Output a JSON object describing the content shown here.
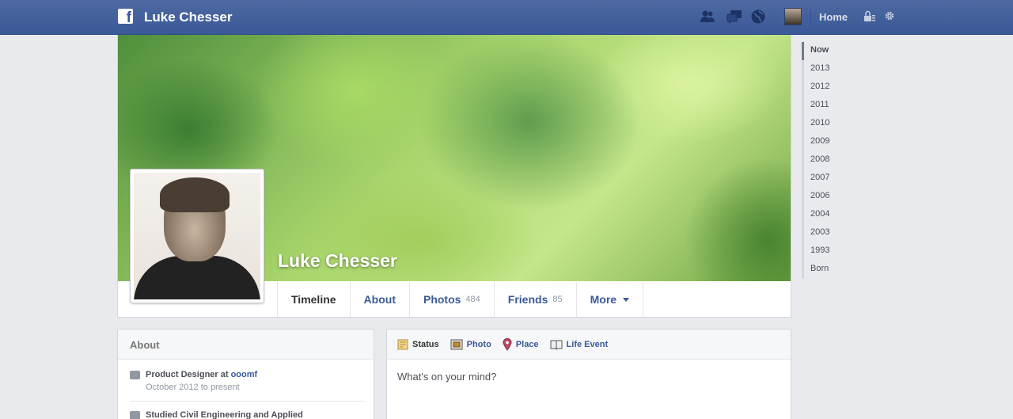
{
  "topbar": {
    "name": "Luke Chesser",
    "home_label": "Home",
    "icons": [
      "friend-requests-icon",
      "messages-icon",
      "notifications-icon",
      "privacy-icon",
      "settings-icon"
    ]
  },
  "cover": {
    "name": "Luke Chesser"
  },
  "tabs": [
    {
      "label": "Timeline",
      "count": ""
    },
    {
      "label": "About",
      "count": ""
    },
    {
      "label": "Photos",
      "count": "484"
    },
    {
      "label": "Friends",
      "count": "85"
    },
    {
      "label": "More",
      "count": ""
    }
  ],
  "years": [
    "Now",
    "2013",
    "2012",
    "2011",
    "2010",
    "2009",
    "2008",
    "2007",
    "2006",
    "2004",
    "2003",
    "1993",
    "Born"
  ],
  "about": {
    "title": "About",
    "job_prefix": "Product Designer at ",
    "job_company": "ooomf",
    "job_dates": "October 2012 to present",
    "education": "Studied Civil Engineering and Applied"
  },
  "composer": {
    "tabs": [
      "Status",
      "Photo",
      "Place",
      "Life Event"
    ],
    "placeholder": "What's on your mind?"
  },
  "colors": {
    "brand": "#3b5998",
    "background": "#e9eaed"
  }
}
